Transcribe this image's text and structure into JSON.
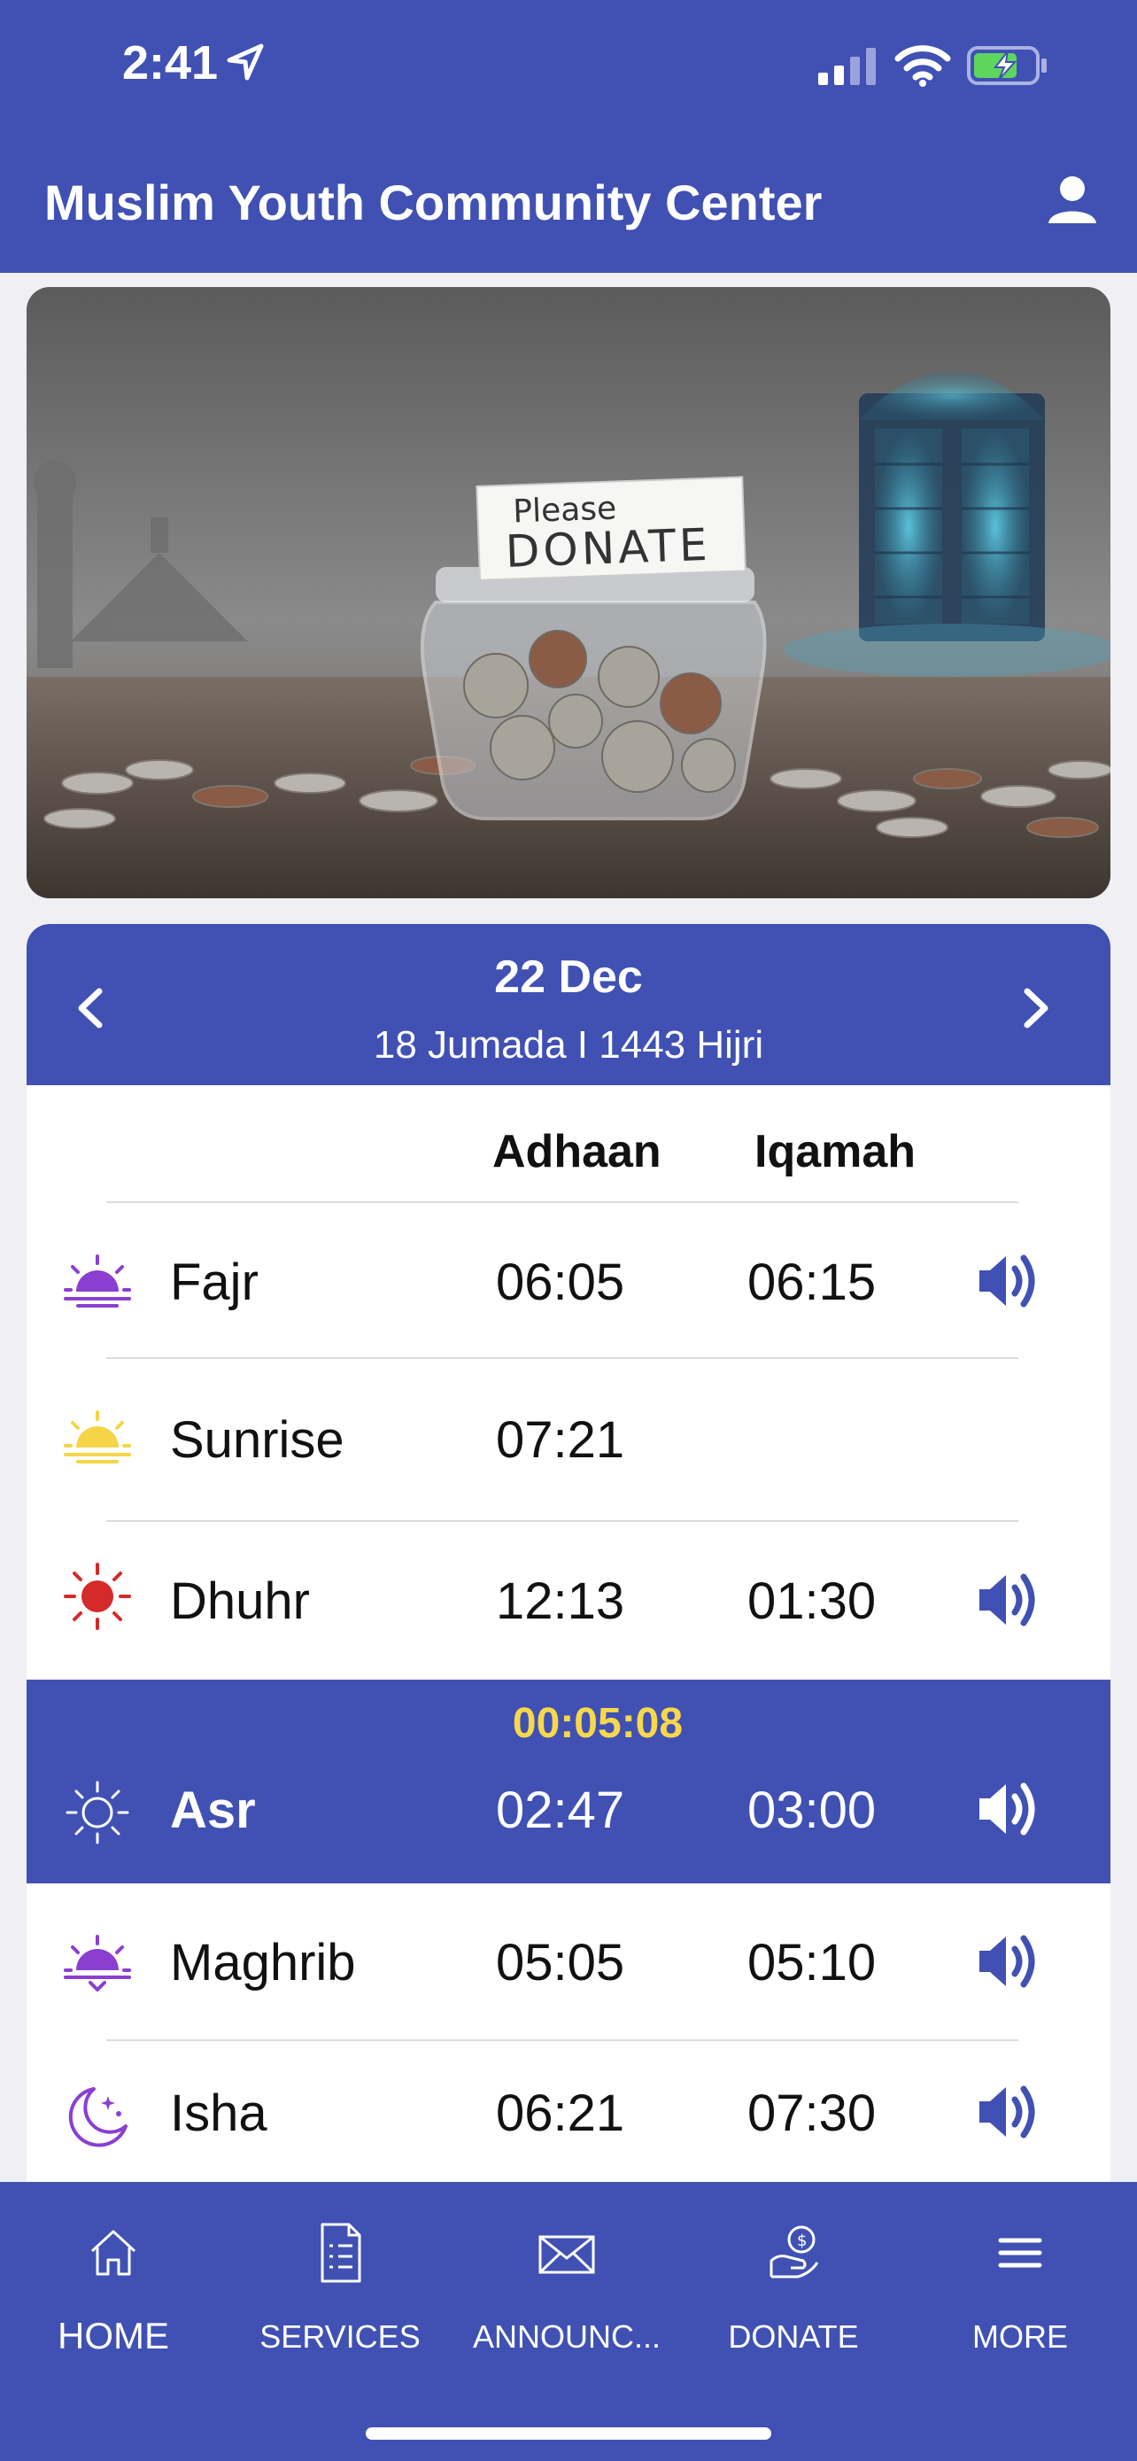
{
  "status": {
    "time": "2:41"
  },
  "header": {
    "title": "Muslim Youth Community Center"
  },
  "banner": {
    "jar_label_top": "Please",
    "jar_label_bottom": "DONATE"
  },
  "date": {
    "gregorian": "22 Dec",
    "hijri": "18 Jumada I 1443 Hijri"
  },
  "columns": {
    "adhaan": "Adhaan",
    "iqamah": "Iqamah"
  },
  "prayers": [
    {
      "name": "Fajr",
      "adhaan": "06:05",
      "iqamah": "06:15",
      "icon": "sunrise-purple-icon"
    },
    {
      "name": "Sunrise",
      "adhaan": "07:21",
      "iqamah": "",
      "icon": "sunrise-yellow-icon"
    },
    {
      "name": "Dhuhr",
      "adhaan": "12:13",
      "iqamah": "01:30",
      "icon": "sun-red-icon"
    },
    {
      "name": "Asr",
      "adhaan": "02:47",
      "iqamah": "03:00",
      "icon": "sun-outline-icon",
      "countdown": "00:05:08"
    },
    {
      "name": "Maghrib",
      "adhaan": "05:05",
      "iqamah": "05:10",
      "icon": "sunset-purple-icon"
    },
    {
      "name": "Isha",
      "adhaan": "06:21",
      "iqamah": "07:30",
      "icon": "moon-stars-icon"
    }
  ],
  "tabs": [
    {
      "label": "HOME",
      "icon": "home-icon"
    },
    {
      "label": "SERVICES",
      "icon": "document-list-icon"
    },
    {
      "label": "ANNOUNC...",
      "icon": "envelope-icon"
    },
    {
      "label": "DONATE",
      "icon": "donate-hand-icon"
    },
    {
      "label": "MORE",
      "icon": "menu-icon"
    }
  ],
  "colors": {
    "brand": "#4051b3",
    "accent_yellow": "#f7d84a",
    "purple": "#8a3fd1",
    "red": "#d42a2a"
  }
}
